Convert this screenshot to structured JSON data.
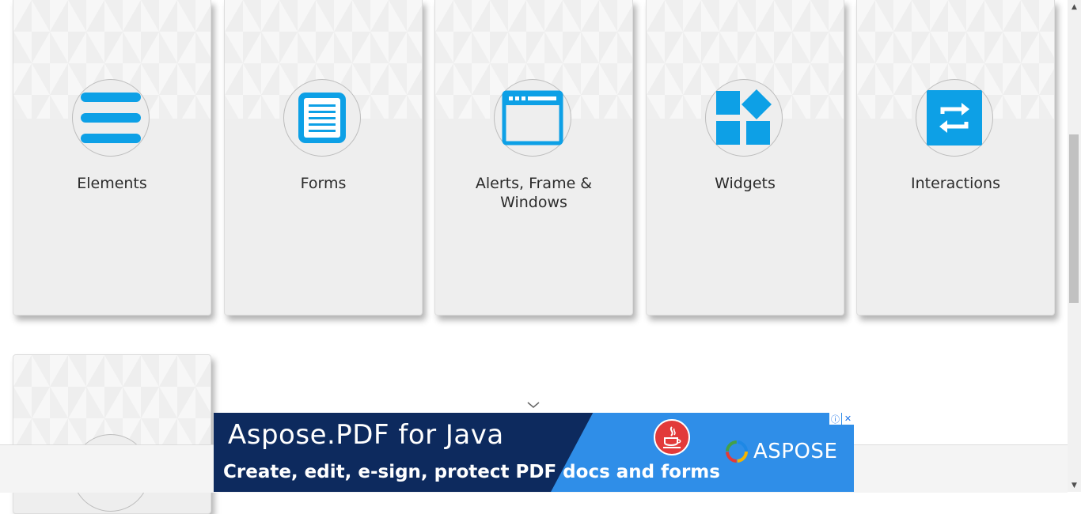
{
  "cards": [
    {
      "title": "Elements",
      "icon": "list-icon"
    },
    {
      "title": "Forms",
      "icon": "document-icon"
    },
    {
      "title": "Alerts, Frame & Windows",
      "icon": "window-icon"
    },
    {
      "title": "Widgets",
      "icon": "widgets-icon"
    },
    {
      "title": "Interactions",
      "icon": "swap-icon"
    },
    {
      "title": "",
      "icon": "unknown-icon"
    }
  ],
  "ad": {
    "title": "Aspose.PDF for Java",
    "subtitle": "Create, edit, e-sign, protect PDF docs and forms",
    "logo_text": "ASPOSE",
    "info_icon": "ⓘ",
    "close_icon": "✕"
  },
  "scrollbar": {
    "up_arrow": "▲",
    "down_arrow": "▼"
  },
  "colors": {
    "accent": "#0da0e6",
    "card_bg": "#eeeeee",
    "ad_dark": "#0d2a5e",
    "ad_light": "#2f8ee8"
  }
}
